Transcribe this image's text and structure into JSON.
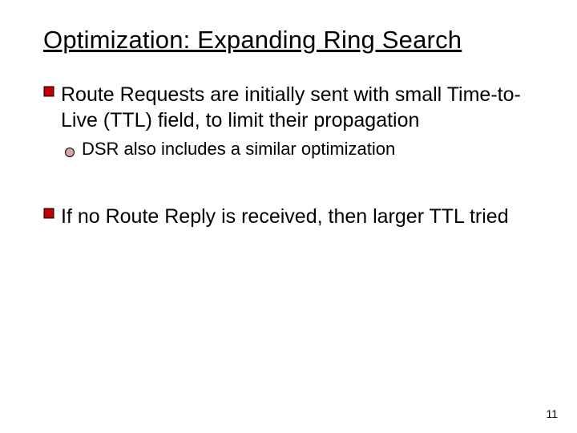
{
  "title": "Optimization: Expanding Ring Search",
  "bullets": [
    {
      "level": 1,
      "text": "Route Requests are initially sent with small Time-to-Live (TTL) field, to limit their propagation"
    },
    {
      "level": 2,
      "text": "DSR also includes a similar optimization"
    },
    {
      "level": 1,
      "text": "If no Route Reply is received, then larger TTL tried"
    }
  ],
  "page_number": "11"
}
